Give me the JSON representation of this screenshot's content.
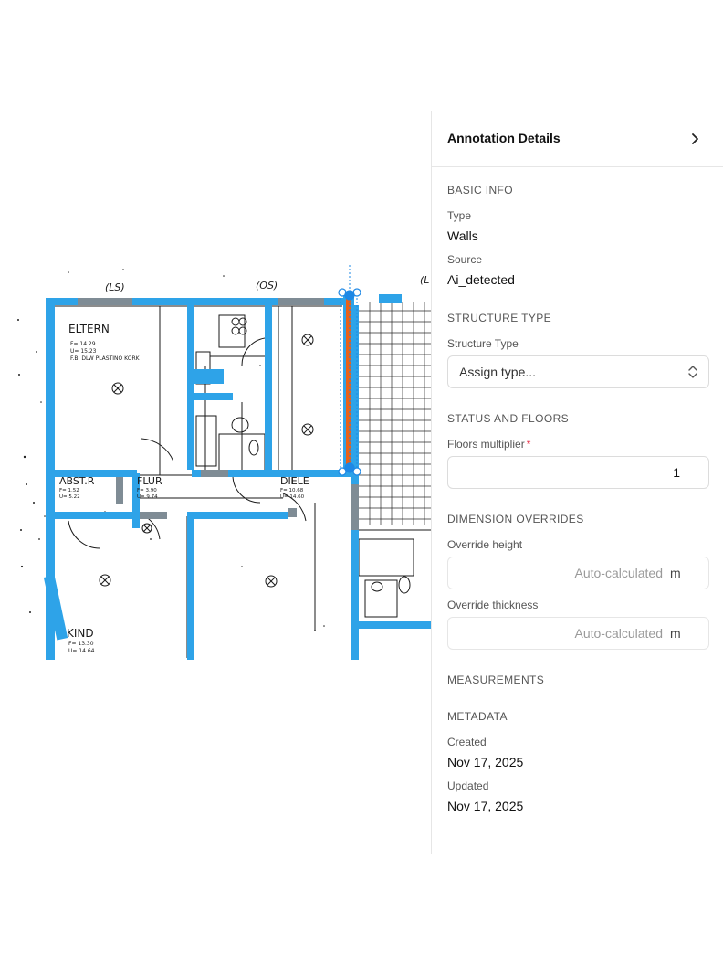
{
  "plan": {
    "dimension_marks": [
      "(LS)",
      "(OS)",
      "(L"
    ],
    "room_labels": {
      "eltern": "ELTERN",
      "eltern_note1": "F= 14.29",
      "eltern_note2": "U= 15.23",
      "eltern_note3": "F.B. DLW PLASTINO KORK",
      "abstr": "ABST.R",
      "abstr_note1": "F= 1.52",
      "abstr_note2": "U= 5.22",
      "flur": "FLUR",
      "flur_note1": "F= 3.90",
      "flur_note2": "U= 9.74",
      "diele": "DIELE",
      "diele_note1": "F= 10.68",
      "diele_note2": "U= 14.60",
      "kind": "KIND",
      "kind_note1": "F= 13.30",
      "kind_note2": "U= 14.64"
    }
  },
  "panel": {
    "title": "Annotation Details",
    "basic_info": {
      "heading": "BASIC INFO",
      "type_label": "Type",
      "type_value": "Walls",
      "source_label": "Source",
      "source_value": "Ai_detected"
    },
    "structure_type": {
      "heading": "STRUCTURE TYPE",
      "label": "Structure Type",
      "select_placeholder": "Assign type..."
    },
    "status_floors": {
      "heading": "STATUS AND FLOORS",
      "label": "Floors multiplier",
      "required_mark": "*",
      "value": "1"
    },
    "dimension_overrides": {
      "heading": "DIMENSION OVERRIDES",
      "height_label": "Override height",
      "height_placeholder": "Auto-calculated",
      "height_unit": "m",
      "thickness_label": "Override thickness",
      "thickness_placeholder": "Auto-calculated",
      "thickness_unit": "m"
    },
    "measurements": {
      "heading": "MEASUREMENTS"
    },
    "metadata": {
      "heading": "METADATA",
      "created_label": "Created",
      "created_value": "Nov 17, 2025",
      "updated_label": "Updated",
      "updated_value": "Nov 17, 2025"
    }
  },
  "colors": {
    "wall_annotation": "#2ea3e8",
    "selected_wall": "#e8621a",
    "selection_handle": "#1e88e5",
    "required": "#e5223b"
  },
  "icons": {
    "collapse": "chevron-right-icon",
    "select": "chevron-up-down-icon"
  }
}
